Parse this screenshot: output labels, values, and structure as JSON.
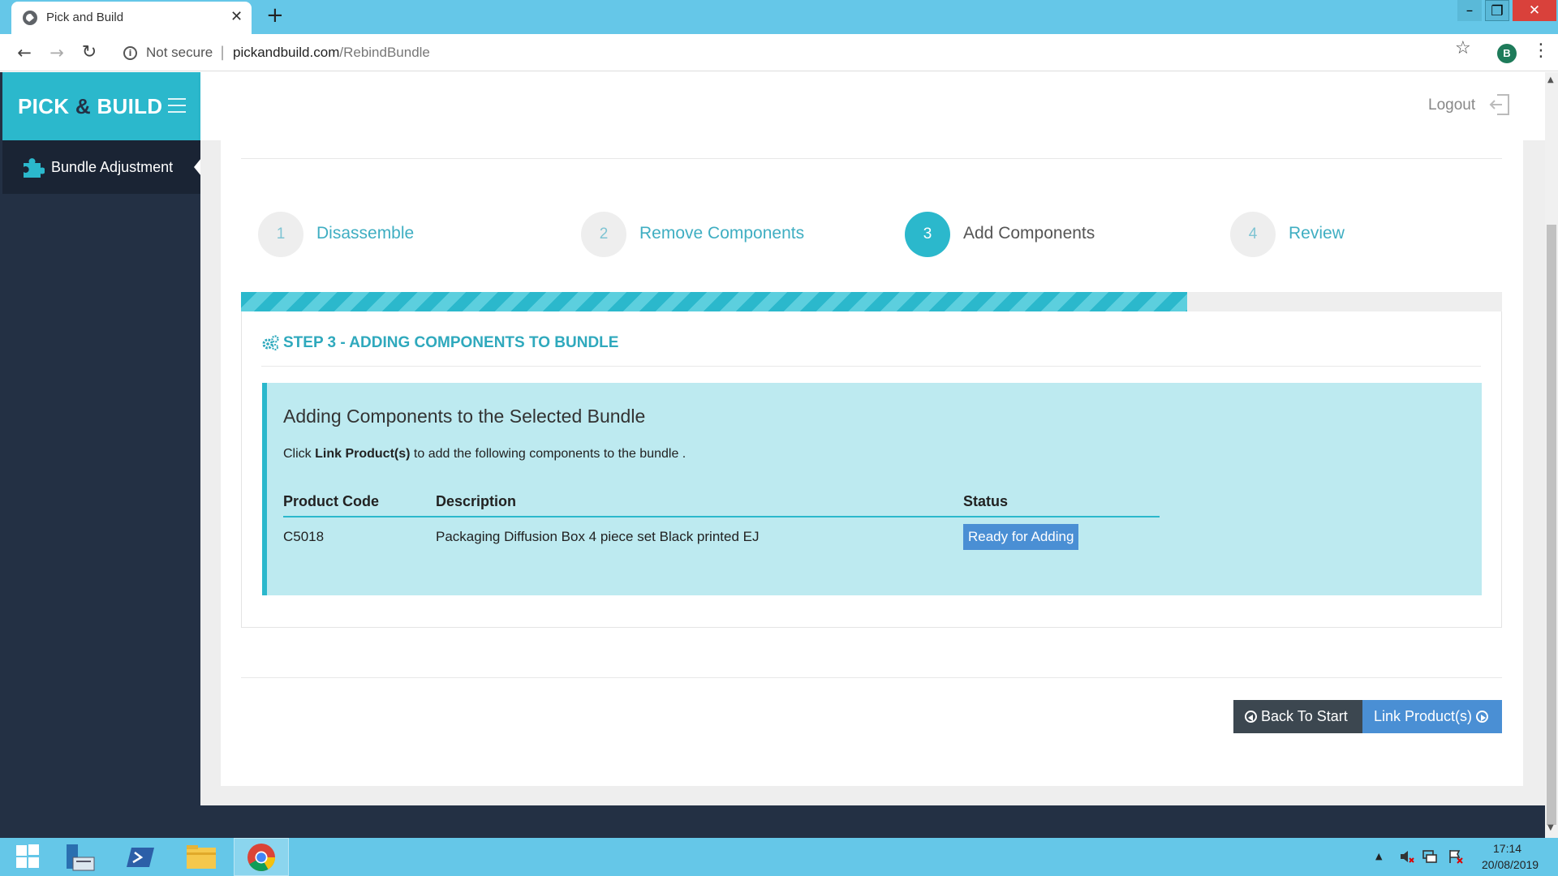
{
  "browser": {
    "tab_title": "Pick and Build",
    "tab_close": "✕",
    "new_tab": "+",
    "security_label": "Not secure",
    "separator": "|",
    "url_host": "pickandbuild.com",
    "url_path": "/RebindBundle",
    "profile_initial": "B",
    "window_min": "–",
    "window_max": "❐",
    "window_close": "✕"
  },
  "app": {
    "brand_left": "PICK ",
    "brand_amp": "&",
    "brand_right": " BUILD",
    "sidebar": {
      "items": [
        {
          "label": "Bundle Adjustment",
          "icon": "puzzle-icon",
          "active": true
        }
      ]
    },
    "header": {
      "logout_label": "Logout",
      "logout_icon": "sign-out-icon"
    },
    "wizard": {
      "steps": [
        {
          "number": "1",
          "label": "Disassemble",
          "state": "done"
        },
        {
          "number": "2",
          "label": "Remove Components",
          "state": "done"
        },
        {
          "number": "3",
          "label": "Add Components",
          "state": "active"
        },
        {
          "number": "4",
          "label": "Review",
          "state": "pending"
        }
      ],
      "progress_percent": 75
    },
    "card": {
      "title": "STEP 3 - ADDING COMPONENTS TO BUNDLE",
      "title_icon": "gears-icon",
      "info_title": "Adding Components to the Selected Bundle",
      "info_prefix": "Click ",
      "info_bold": "Link Product(s)",
      "info_suffix": " to add the following components to the bundle .",
      "table": {
        "columns": [
          "Product Code",
          "Description",
          "Status"
        ],
        "rows": [
          {
            "code": "C5018",
            "description": "Packaging Diffusion Box 4 piece set Black printed EJ",
            "status": "Ready for Adding"
          }
        ]
      }
    },
    "buttons": {
      "back_label": "Back To Start",
      "link_label": "Link Product(s)"
    }
  },
  "colors": {
    "brand": "#2bb8cc",
    "sidebar": "#233044",
    "status_badge": "#4a8fd4",
    "back_button": "#3c4750",
    "taskbar": "#65c7e8"
  },
  "taskbar": {
    "time": "17:14",
    "date": "20/08/2019"
  }
}
